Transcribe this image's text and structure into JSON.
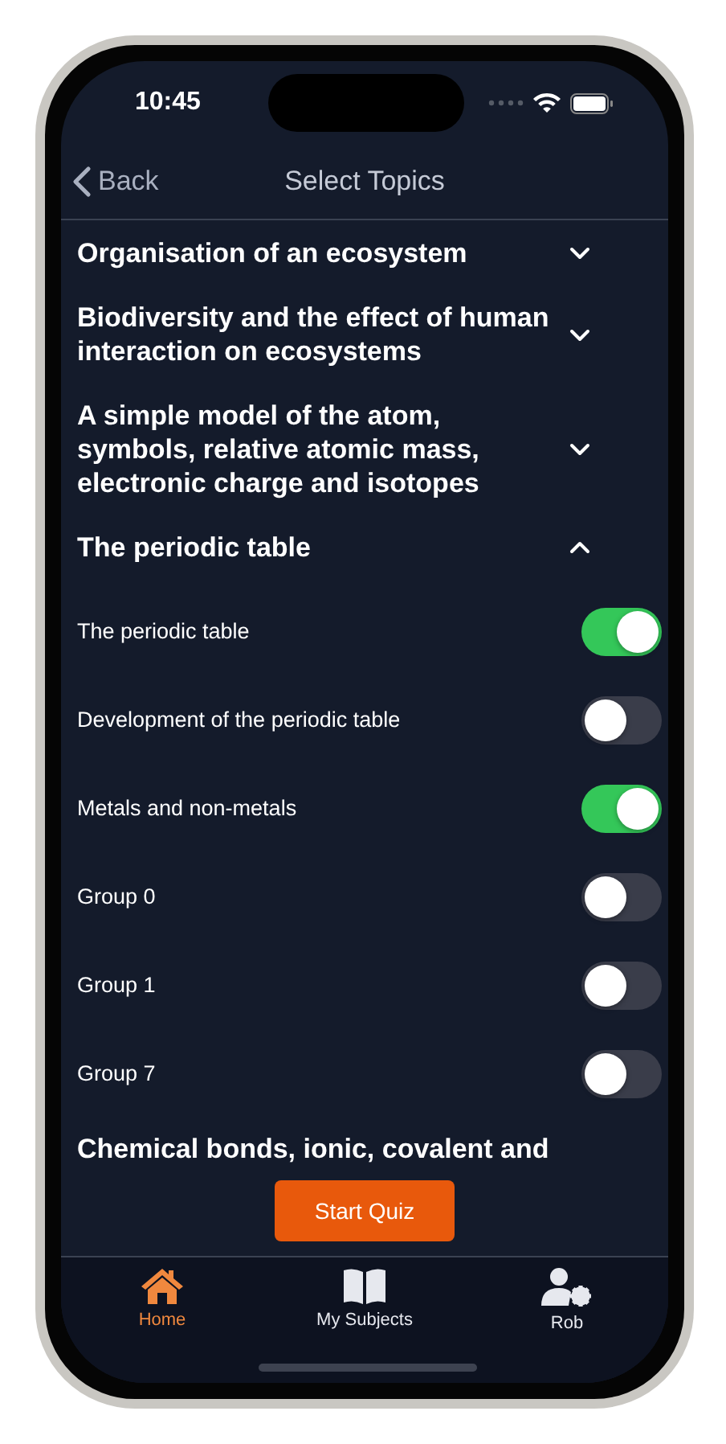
{
  "status_bar": {
    "time": "10:45"
  },
  "nav": {
    "back": "Back",
    "title": "Select Topics"
  },
  "sections": [
    {
      "title": "Organisation of an ecosystem",
      "expanded": false
    },
    {
      "title": "Biodiversity and the effect of human interaction on ecosystems",
      "expanded": false
    },
    {
      "title": "A simple model of the atom, symbols, relative atomic mass, electronic charge and isotopes",
      "expanded": false
    },
    {
      "title": "The periodic table",
      "expanded": true,
      "topics": [
        {
          "label": "The periodic table",
          "on": true
        },
        {
          "label": "Development of the periodic table",
          "on": false
        },
        {
          "label": "Metals and non-metals",
          "on": true
        },
        {
          "label": "Group 0",
          "on": false
        },
        {
          "label": "Group 1",
          "on": false
        },
        {
          "label": "Group 7",
          "on": false
        }
      ]
    },
    {
      "title": "Chemical bonds, ionic, covalent and"
    }
  ],
  "start_button": "Start Quiz",
  "tab_bar": [
    {
      "kind": "home",
      "label": "Home",
      "selected": true
    },
    {
      "kind": "book",
      "label": "My Subjects",
      "selected": false
    },
    {
      "kind": "profile",
      "label": "Rob",
      "selected": false
    }
  ]
}
